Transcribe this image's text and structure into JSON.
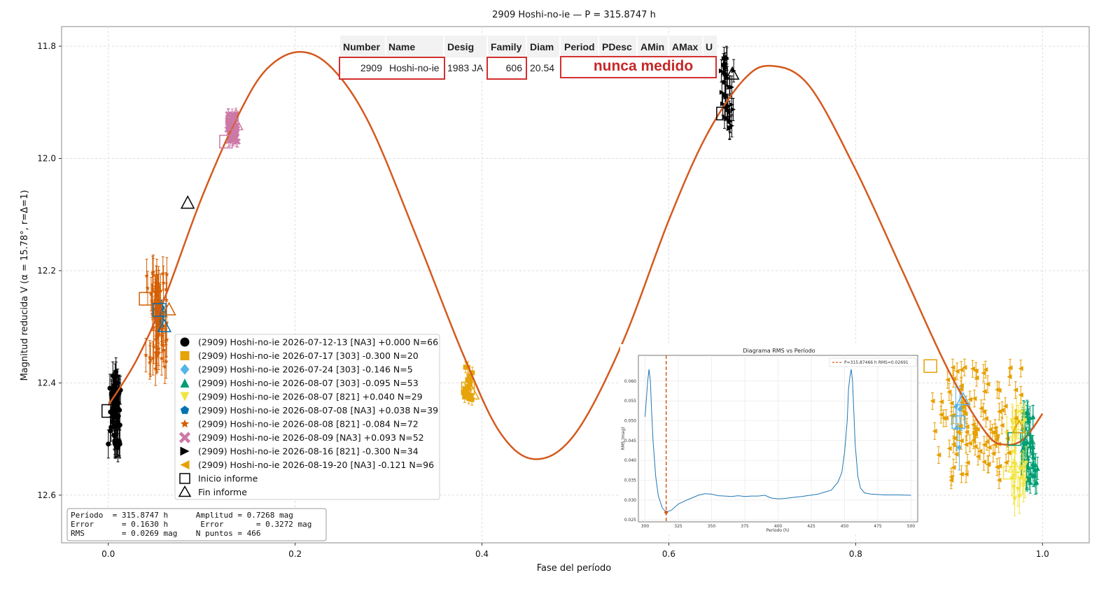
{
  "chart_data": {
    "type": "scatter",
    "title": "2909 Hoshi-no-ie — P = 315.8747 h",
    "xlabel": "Fase del período",
    "ylabel": "Magnitud reducida V  (α = 15.78°, r=Δ=1)",
    "xlim": [
      -0.05,
      1.05
    ],
    "ylim": [
      12.685,
      11.765
    ],
    "y_inverted": true,
    "x_ticks": [
      "0.0",
      "0.2",
      "0.4",
      "0.6",
      "0.8",
      "1.0"
    ],
    "y_ticks": [
      "11.8",
      "12.0",
      "12.2",
      "12.4",
      "12.6"
    ],
    "grid": true,
    "legend_location": "lower-left",
    "fit_curve_color": "#d45a1e",
    "fit_curve": [
      [
        0.0,
        12.44
      ],
      [
        0.03,
        12.36
      ],
      [
        0.06,
        12.25
      ],
      [
        0.1,
        12.07
      ],
      [
        0.14,
        11.92
      ],
      [
        0.17,
        11.84
      ],
      [
        0.205,
        11.81
      ],
      [
        0.24,
        11.84
      ],
      [
        0.28,
        11.94
      ],
      [
        0.33,
        12.14
      ],
      [
        0.38,
        12.35
      ],
      [
        0.42,
        12.49
      ],
      [
        0.458,
        12.536
      ],
      [
        0.5,
        12.49
      ],
      [
        0.55,
        12.33
      ],
      [
        0.6,
        12.11
      ],
      [
        0.64,
        11.96
      ],
      [
        0.68,
        11.86
      ],
      [
        0.71,
        11.835
      ],
      [
        0.75,
        11.87
      ],
      [
        0.8,
        12.02
      ],
      [
        0.85,
        12.2
      ],
      [
        0.9,
        12.38
      ],
      [
        0.94,
        12.49
      ],
      [
        0.96,
        12.51
      ],
      [
        0.98,
        12.5
      ],
      [
        1.0,
        12.455
      ]
    ],
    "series": [
      {
        "name": "(2909) Hoshi-no-ie 2026-07-12-13 [NA3] +0.000 N=66",
        "color": "#000000",
        "marker": "circle",
        "x_range": [
          0.0,
          0.015
        ],
        "y_range": [
          12.38,
          12.52
        ],
        "y_err": 0.025
      },
      {
        "name": "(2909) Hoshi-no-ie 2026-07-17 [303] -0.300 N=20",
        "color": "#e6a40a",
        "marker": "square",
        "x_range": [
          0.38,
          0.39
        ],
        "y_range": [
          12.37,
          12.43
        ],
        "y_err": 0.01
      },
      {
        "name": "(2909) Hoshi-no-ie 2026-07-24 [303] -0.146 N=5",
        "color": "#56b4e9",
        "marker": "diamond",
        "x_range": [
          0.905,
          0.915
        ],
        "y_range": [
          12.43,
          12.52
        ],
        "y_err": 0.04
      },
      {
        "name": "(2909) Hoshi-no-ie 2026-08-07 [303] -0.095 N=53",
        "color": "#009e73",
        "marker": "triangle-up",
        "x_range": [
          0.975,
          0.995
        ],
        "y_range": [
          12.45,
          12.58
        ],
        "y_err": 0.02
      },
      {
        "name": "(2909) Hoshi-no-ie 2026-08-07 [821] +0.040 N=29",
        "color": "#f0e442",
        "marker": "triangle-down",
        "x_range": [
          0.96,
          0.985
        ],
        "y_range": [
          12.45,
          12.62
        ],
        "y_err": 0.03
      },
      {
        "name": "(2909) Hoshi-no-ie 2026-08-07-08 [NA3] +0.038 N=39",
        "color": "#0072b2",
        "marker": "pentagon",
        "x_range": [
          0.05,
          0.06
        ],
        "y_range": [
          12.26,
          12.3
        ],
        "y_err": 0.01
      },
      {
        "name": "(2909) Hoshi-no-ie 2026-08-08 [821] -0.084 N=72",
        "color": "#d55e00",
        "marker": "star",
        "x_range": [
          0.04,
          0.065
        ],
        "y_range": [
          12.2,
          12.38
        ],
        "y_err": 0.03
      },
      {
        "name": "(2909) Hoshi-no-ie 2026-08-09 [NA3] +0.093 N=52",
        "color": "#cc79a7",
        "marker": "x",
        "x_range": [
          0.125,
          0.14
        ],
        "y_range": [
          11.92,
          11.97
        ],
        "y_err": 0.01
      },
      {
        "name": "(2909) Hoshi-no-ie 2026-08-16 [821] -0.300 N=34",
        "color": "#000000",
        "marker": "triangle-right",
        "x_range": [
          0.655,
          0.67
        ],
        "y_range": [
          11.82,
          11.95
        ],
        "y_err": 0.02
      },
      {
        "name": "(2909) Hoshi-no-ie 2026-08-19-20 [NA3] -0.121 N=96",
        "color": "#e69f00",
        "marker": "triangle-left",
        "x_range": [
          0.88,
          0.98
        ],
        "y_range": [
          12.37,
          12.58
        ],
        "y_err": 0.015
      }
    ],
    "legend_extra": [
      "Inicio informe",
      "Fin informe"
    ],
    "session_start_markers": [
      [
        0.0,
        12.45
      ],
      [
        0.385,
        12.41
      ],
      [
        0.91,
        12.47
      ],
      [
        0.97,
        12.5
      ],
      [
        0.965,
        12.56
      ],
      [
        0.055,
        12.27
      ],
      [
        0.04,
        12.25
      ],
      [
        0.126,
        11.97
      ],
      [
        0.658,
        11.92
      ],
      [
        0.88,
        12.37
      ]
    ],
    "session_end_markers": [
      [
        0.085,
        12.08
      ],
      [
        0.39,
        12.42
      ],
      [
        0.915,
        12.43
      ],
      [
        0.985,
        12.5
      ],
      [
        0.97,
        12.55
      ],
      [
        0.06,
        12.3
      ],
      [
        0.065,
        12.27
      ],
      [
        0.137,
        11.94
      ],
      [
        0.668,
        11.85
      ],
      [
        0.975,
        12.48
      ]
    ],
    "stats_box": [
      "Período  = 315.8747 h      Amplitud = 0.7268 mag",
      "Error      = 0.1630 h       Error       = 0.3272 mag",
      "RMS        = 0.0269 mag    N puntos = 466"
    ],
    "inset": {
      "type": "line",
      "title": "Diagrama RMS vs Período",
      "xlabel": "Período (h)",
      "ylabel": "RMS (mag)",
      "xlim": [
        295,
        505
      ],
      "ylim": [
        0.0245,
        0.0665
      ],
      "x_ticks": [
        "300",
        "325",
        "350",
        "375",
        "400",
        "425",
        "450",
        "475",
        "500"
      ],
      "y_ticks": [
        "0.025",
        "0.030",
        "0.035",
        "0.040",
        "0.045",
        "0.050",
        "0.055",
        "0.060"
      ],
      "legend": "P=315.87466 h   RMS=0.02691",
      "best_period": 315.87466,
      "best_rms": 0.02691,
      "x": [
        300,
        302,
        303,
        304,
        305,
        306,
        308,
        310,
        313,
        316,
        320,
        325,
        330,
        335,
        340,
        345,
        350,
        355,
        360,
        365,
        370,
        375,
        380,
        385,
        390,
        395,
        400,
        405,
        410,
        420,
        430,
        440,
        445,
        448,
        450,
        452,
        453,
        454,
        455,
        456,
        457,
        458,
        460,
        462,
        465,
        470,
        480,
        490,
        500
      ],
      "y": [
        0.051,
        0.06,
        0.063,
        0.06,
        0.052,
        0.045,
        0.036,
        0.031,
        0.028,
        0.0269,
        0.0275,
        0.029,
        0.0298,
        0.0305,
        0.0312,
        0.0316,
        0.0315,
        0.0311,
        0.031,
        0.0309,
        0.0311,
        0.0309,
        0.031,
        0.031,
        0.0312,
        0.0305,
        0.0303,
        0.0304,
        0.0306,
        0.031,
        0.0315,
        0.0325,
        0.0345,
        0.037,
        0.042,
        0.05,
        0.058,
        0.061,
        0.063,
        0.06,
        0.052,
        0.044,
        0.036,
        0.033,
        0.0318,
        0.0315,
        0.0313,
        0.0313,
        0.0312
      ]
    }
  },
  "info_table": {
    "headers": [
      "Number",
      "Name",
      "Desig",
      "Family",
      "Diam",
      "Period",
      "PDesc",
      "AMin",
      "AMax",
      "U"
    ],
    "row": {
      "number": "2909",
      "name": "Hoshi-no-ie",
      "desig": "1983 JA",
      "family": "606",
      "diam": "20.54"
    },
    "note": "nunca medido"
  }
}
